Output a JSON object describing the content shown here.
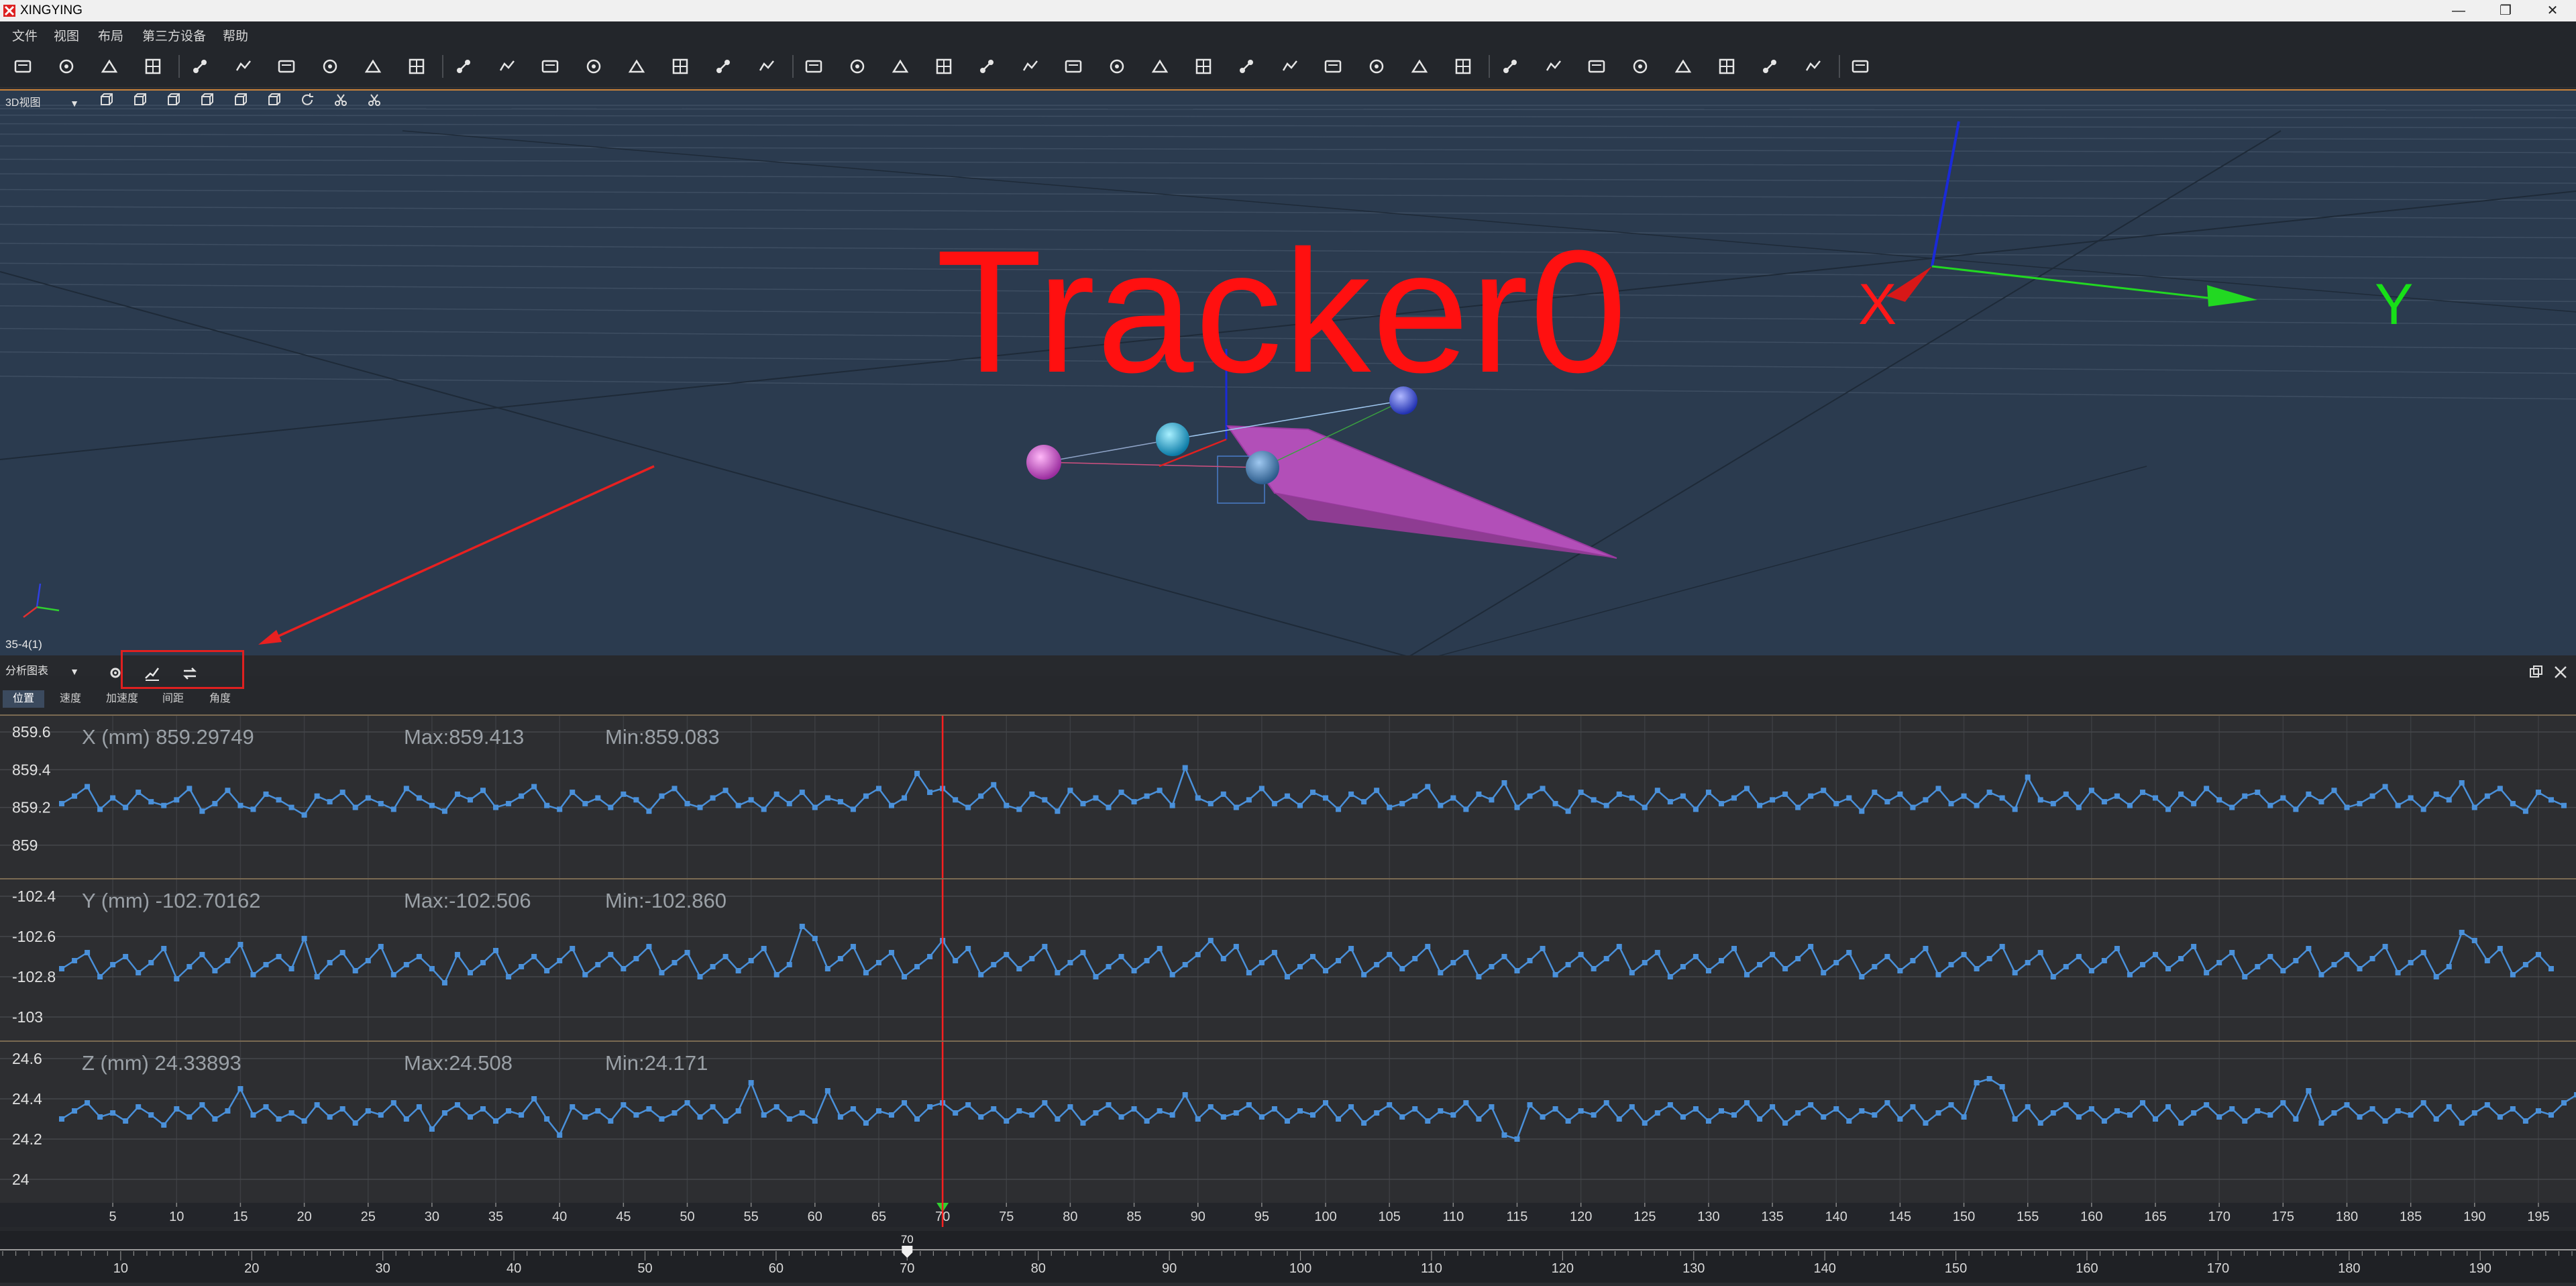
{
  "window": {
    "title": "XINGYING",
    "controls": [
      "—",
      "❐",
      "✕"
    ]
  },
  "menu": [
    "文件",
    "视图",
    "布局",
    "第三方设备",
    "帮助"
  ],
  "toolbar": {
    "icons": [
      "open-file-icon",
      "import-icon",
      "save-icon",
      "save-as-icon",
      "hide-icon",
      "device-icon",
      "layers-icon",
      "camera-icon",
      "edit-icon",
      "settings-icon",
      "layout-1-icon",
      "layout-2-icon",
      "layout-3-icon",
      "layout-4-icon",
      "layout-5-icon",
      "layout-6-icon",
      "layout-7-icon",
      "layout-8-icon",
      "link-markers-icon",
      "markers-icon",
      "merge-icon",
      "rigid-icon",
      "cut-icon",
      "bone-icon",
      "joint-icon",
      "calculator-icon",
      "circle-icon",
      "delete-marker-icon",
      "wave-icon",
      "trim-icon",
      "select-icon",
      "target-icon",
      "run-icon",
      "undo-icon",
      "export-icon",
      "video-icon",
      "speed-icon",
      "share-icon",
      "bar-chart-icon",
      "vm-icon",
      "hc-icon",
      "document-icon",
      "axes-icon"
    ]
  },
  "view3d": {
    "mode": "3D视图",
    "tracker_label": "Tracker0",
    "frame_indicator": "35-4(1)",
    "axis_x": "X",
    "axis_y": "Y",
    "tools": [
      "cube-front-icon",
      "cube-back-icon",
      "cube-left-icon",
      "cube-right-icon",
      "cube-top-icon",
      "cube-bottom-icon",
      "refresh-icon",
      "scissors-icon",
      "marker-tool-icon"
    ]
  },
  "analysis": {
    "mode": "分析图表",
    "tabs": [
      "位置",
      "速度",
      "加速度",
      "间距",
      "角度"
    ],
    "active_tab": "位置"
  },
  "charts": [
    {
      "title": "X (mm) 859.29749",
      "max": "Max:859.413",
      "min": "Min:859.083",
      "ylabels": [
        "859.6",
        "859.4",
        "859.2",
        "859"
      ],
      "yvalues": [
        859.6,
        859.4,
        859.2,
        859.0
      ]
    },
    {
      "title": "Y (mm) -102.70162",
      "max": "Max:-102.506",
      "min": "Min:-102.860",
      "ylabels": [
        "-102.4",
        "-102.6",
        "-102.8",
        "-103"
      ],
      "yvalues": [
        -102.4,
        -102.6,
        -102.8,
        -103.0
      ]
    },
    {
      "title": "Z (mm) 24.33893",
      "max": "Max:24.508",
      "min": "Min:24.171",
      "ylabels": [
        "24.6",
        "24.4",
        "24.2",
        "24"
      ],
      "yvalues": [
        24.6,
        24.4,
        24.2,
        24.0
      ]
    }
  ],
  "chart_data": [
    {
      "type": "line",
      "title": "X (mm) 859.29749",
      "xlim": [
        1,
        197
      ],
      "ylim": [
        858.85,
        859.65
      ],
      "x_ticks": [
        5,
        10,
        15,
        20,
        25,
        30,
        35,
        40,
        45,
        50,
        55,
        60,
        65,
        70,
        75,
        80,
        85,
        90,
        95,
        100,
        105,
        110,
        115,
        120,
        125,
        130,
        135,
        140,
        145,
        150,
        155,
        160,
        165,
        170,
        175,
        180,
        185,
        190,
        195
      ],
      "cursor_frame": 70,
      "max": 859.413,
      "min": 859.083,
      "series": [
        {
          "values": [
            859.22,
            859.26,
            859.31,
            859.19,
            859.25,
            859.2,
            859.28,
            859.23,
            859.21,
            859.24,
            859.3,
            859.18,
            859.22,
            859.29,
            859.21,
            859.19,
            859.27,
            859.24,
            859.2,
            859.16,
            859.26,
            859.23,
            859.28,
            859.2,
            859.25,
            859.22,
            859.19,
            859.3,
            859.25,
            859.21,
            859.18,
            859.27,
            859.24,
            859.29,
            859.2,
            859.22,
            859.26,
            859.31,
            859.21,
            859.19,
            859.28,
            859.22,
            859.25,
            859.2,
            859.27,
            859.24,
            859.18,
            859.26,
            859.3,
            859.22,
            859.2,
            859.25,
            859.29,
            859.21,
            859.24,
            859.19,
            859.27,
            859.22,
            859.28,
            859.2,
            859.25,
            859.23,
            859.19,
            859.26,
            859.3,
            859.21,
            859.25,
            859.38,
            859.28,
            859.3,
            859.24,
            859.2,
            859.26,
            859.32,
            859.21,
            859.19,
            859.27,
            859.24,
            859.18,
            859.29,
            859.22,
            859.25,
            859.2,
            859.28,
            859.23,
            859.26,
            859.29,
            859.21,
            859.41,
            859.25,
            859.22,
            859.27,
            859.2,
            859.24,
            859.3,
            859.22,
            859.26,
            859.21,
            859.28,
            859.25,
            859.19,
            859.27,
            859.23,
            859.29,
            859.2,
            859.22,
            859.26,
            859.31,
            859.21,
            859.25,
            859.19,
            859.27,
            859.24,
            859.33,
            859.2,
            859.26,
            859.3,
            859.22,
            859.18,
            859.28,
            859.24,
            859.21,
            859.27,
            859.25,
            859.2,
            859.29,
            859.23,
            859.26,
            859.19,
            859.28,
            859.22,
            859.25,
            859.3,
            859.21,
            859.24,
            859.27,
            859.2,
            859.26,
            859.29,
            859.22,
            859.25,
            859.18,
            859.28,
            859.23,
            859.27,
            859.2,
            859.24,
            859.3,
            859.22,
            859.26,
            859.21,
            859.28,
            859.25,
            859.19,
            859.36,
            859.24,
            859.22,
            859.27,
            859.2,
            859.29,
            859.23,
            859.26,
            859.21,
            859.28,
            859.25,
            859.19,
            859.27,
            859.22,
            859.3,
            859.24,
            859.2,
            859.26,
            859.28,
            859.21,
            859.25,
            859.19,
            859.27,
            859.23,
            859.29,
            859.2,
            859.22,
            859.26,
            859.31,
            859.21,
            859.25,
            859.19,
            859.27,
            859.24,
            859.33,
            859.2,
            859.26,
            859.3,
            859.22,
            859.18,
            859.28,
            859.24,
            859.21
          ]
        }
      ]
    },
    {
      "type": "line",
      "title": "Y (mm) -102.70162",
      "xlim": [
        1,
        197
      ],
      "ylim": [
        -103.1,
        -102.35
      ],
      "x_ticks": [
        5,
        10,
        15,
        20,
        25,
        30,
        35,
        40,
        45,
        50,
        55,
        60,
        65,
        70,
        75,
        80,
        85,
        90,
        95,
        100,
        105,
        110,
        115,
        120,
        125,
        130,
        135,
        140,
        145,
        150,
        155,
        160,
        165,
        170,
        175,
        180,
        185,
        190,
        195
      ],
      "cursor_frame": 70,
      "max": -102.506,
      "min": -102.86,
      "series": [
        {
          "values": [
            -102.76,
            -102.72,
            -102.68,
            -102.8,
            -102.74,
            -102.7,
            -102.78,
            -102.73,
            -102.66,
            -102.81,
            -102.75,
            -102.69,
            -102.77,
            -102.72,
            -102.64,
            -102.79,
            -102.74,
            -102.7,
            -102.76,
            -102.61,
            -102.8,
            -102.73,
            -102.68,
            -102.77,
            -102.72,
            -102.65,
            -102.79,
            -102.74,
            -102.7,
            -102.76,
            -102.83,
            -102.69,
            -102.78,
            -102.73,
            -102.67,
            -102.8,
            -102.75,
            -102.7,
            -102.77,
            -102.72,
            -102.66,
            -102.79,
            -102.74,
            -102.69,
            -102.76,
            -102.71,
            -102.65,
            -102.78,
            -102.73,
            -102.68,
            -102.8,
            -102.75,
            -102.7,
            -102.77,
            -102.72,
            -102.66,
            -102.79,
            -102.74,
            -102.55,
            -102.61,
            -102.76,
            -102.71,
            -102.65,
            -102.78,
            -102.73,
            -102.68,
            -102.8,
            -102.75,
            -102.7,
            -102.62,
            -102.72,
            -102.66,
            -102.79,
            -102.74,
            -102.69,
            -102.76,
            -102.71,
            -102.65,
            -102.78,
            -102.73,
            -102.68,
            -102.8,
            -102.75,
            -102.7,
            -102.77,
            -102.72,
            -102.66,
            -102.79,
            -102.74,
            -102.69,
            -102.62,
            -102.71,
            -102.65,
            -102.78,
            -102.73,
            -102.68,
            -102.8,
            -102.75,
            -102.7,
            -102.77,
            -102.72,
            -102.66,
            -102.79,
            -102.74,
            -102.69,
            -102.76,
            -102.71,
            -102.65,
            -102.78,
            -102.73,
            -102.68,
            -102.8,
            -102.75,
            -102.7,
            -102.77,
            -102.72,
            -102.66,
            -102.79,
            -102.74,
            -102.69,
            -102.76,
            -102.71,
            -102.65,
            -102.78,
            -102.73,
            -102.68,
            -102.8,
            -102.75,
            -102.7,
            -102.77,
            -102.72,
            -102.66,
            -102.79,
            -102.74,
            -102.69,
            -102.76,
            -102.71,
            -102.65,
            -102.78,
            -102.73,
            -102.68,
            -102.8,
            -102.75,
            -102.7,
            -102.77,
            -102.72,
            -102.66,
            -102.79,
            -102.74,
            -102.69,
            -102.76,
            -102.71,
            -102.65,
            -102.78,
            -102.73,
            -102.68,
            -102.8,
            -102.75,
            -102.7,
            -102.77,
            -102.72,
            -102.66,
            -102.79,
            -102.74,
            -102.69,
            -102.76,
            -102.71,
            -102.65,
            -102.78,
            -102.73,
            -102.68,
            -102.8,
            -102.75,
            -102.7,
            -102.77,
            -102.72,
            -102.66,
            -102.79,
            -102.74,
            -102.69,
            -102.76,
            -102.71,
            -102.65,
            -102.78,
            -102.73,
            -102.68,
            -102.8,
            -102.75,
            -102.58,
            -102.62,
            -102.72,
            -102.66,
            -102.79,
            -102.74,
            -102.69,
            -102.76
          ]
        }
      ]
    },
    {
      "type": "line",
      "title": "Z (mm) 24.33893",
      "xlim": [
        1,
        197
      ],
      "ylim": [
        23.9,
        24.65
      ],
      "x_ticks": [
        5,
        10,
        15,
        20,
        25,
        30,
        35,
        40,
        45,
        50,
        55,
        60,
        65,
        70,
        75,
        80,
        85,
        90,
        95,
        100,
        105,
        110,
        115,
        120,
        125,
        130,
        135,
        140,
        145,
        150,
        155,
        160,
        165,
        170,
        175,
        180,
        185,
        190,
        195
      ],
      "cursor_frame": 70,
      "max": 24.508,
      "min": 24.171,
      "series": [
        {
          "values": [
            24.3,
            24.34,
            24.38,
            24.31,
            24.33,
            24.29,
            24.36,
            24.32,
            24.27,
            24.35,
            24.31,
            24.37,
            24.3,
            24.34,
            24.45,
            24.32,
            24.36,
            24.3,
            24.33,
            24.29,
            24.37,
            24.31,
            24.35,
            24.28,
            24.34,
            24.32,
            24.38,
            24.3,
            24.36,
            24.25,
            24.33,
            24.37,
            24.31,
            24.35,
            24.29,
            24.34,
            24.32,
            24.4,
            24.3,
            24.22,
            24.36,
            24.31,
            24.34,
            24.29,
            24.37,
            24.32,
            24.35,
            24.3,
            24.33,
            24.38,
            24.31,
            24.36,
            24.29,
            24.34,
            24.48,
            24.32,
            24.36,
            24.3,
            24.33,
            24.29,
            24.44,
            24.31,
            24.35,
            24.28,
            24.34,
            24.32,
            24.38,
            24.3,
            24.36,
            24.38,
            24.33,
            24.37,
            24.31,
            24.35,
            24.29,
            24.34,
            24.32,
            24.38,
            24.3,
            24.36,
            24.28,
            24.33,
            24.37,
            24.31,
            24.35,
            24.29,
            24.34,
            24.32,
            24.42,
            24.3,
            24.36,
            24.31,
            24.33,
            24.37,
            24.31,
            24.35,
            24.29,
            24.34,
            24.32,
            24.38,
            24.3,
            24.36,
            24.28,
            24.33,
            24.37,
            24.31,
            24.35,
            24.29,
            24.34,
            24.32,
            24.38,
            24.3,
            24.36,
            24.22,
            24.2,
            24.37,
            24.31,
            24.35,
            24.29,
            24.34,
            24.32,
            24.38,
            24.3,
            24.36,
            24.28,
            24.33,
            24.37,
            24.31,
            24.35,
            24.29,
            24.34,
            24.32,
            24.38,
            24.3,
            24.36,
            24.28,
            24.33,
            24.37,
            24.31,
            24.35,
            24.29,
            24.34,
            24.32,
            24.38,
            24.3,
            24.36,
            24.28,
            24.33,
            24.37,
            24.31,
            24.48,
            24.5,
            24.46,
            24.3,
            24.36,
            24.28,
            24.33,
            24.37,
            24.31,
            24.35,
            24.29,
            24.34,
            24.32,
            24.38,
            24.3,
            24.36,
            24.28,
            24.33,
            24.37,
            24.31,
            24.35,
            24.29,
            24.34,
            24.32,
            24.38,
            24.3,
            24.44,
            24.28,
            24.33,
            24.37,
            24.31,
            24.35,
            24.29,
            24.34,
            24.32,
            24.38,
            24.3,
            24.36,
            24.28,
            24.33,
            24.37,
            24.31,
            24.35,
            24.29,
            24.34,
            24.32,
            24.38,
            24.42,
            24.36,
            24.3
          ]
        }
      ]
    }
  ],
  "timeline": {
    "current_label": "70",
    "current_frame": 70,
    "tick_labels": [
      "10",
      "20",
      "30",
      "40",
      "50",
      "60",
      "70",
      "80",
      "90",
      "100",
      "110",
      "120",
      "130",
      "140",
      "150",
      "160",
      "170",
      "180",
      "190"
    ],
    "tick_frames": [
      10,
      20,
      30,
      40,
      50,
      60,
      70,
      80,
      90,
      100,
      110,
      120,
      130,
      140,
      150,
      160,
      170,
      180,
      190
    ],
    "range": [
      1,
      197
    ]
  },
  "colors": {
    "accent_orange": "#c8823a",
    "cursor_red": "#ff2020",
    "series_blue": "#4a90d9",
    "viewport_bg": "#2b3b4f",
    "tracker_magenta": "#b24fb8"
  }
}
